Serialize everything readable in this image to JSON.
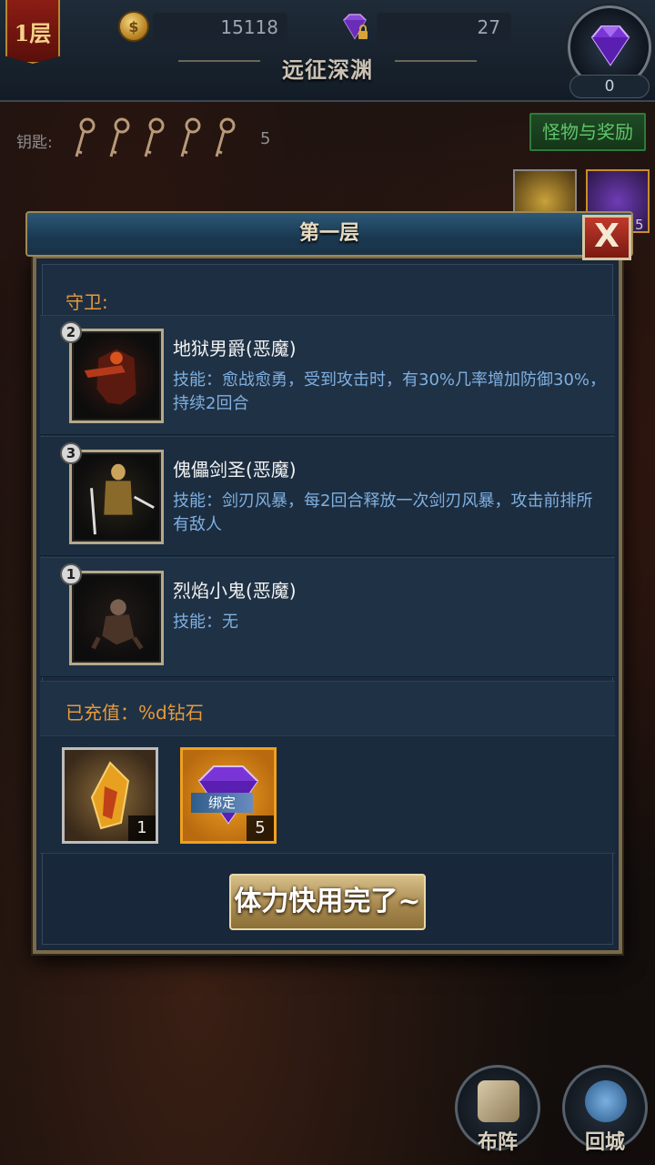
{
  "topbar": {
    "floor_badge": "1层",
    "coins": "15118",
    "diamonds": "27",
    "gem_count": "0",
    "title": "远征深渊"
  },
  "keys": {
    "label": "钥匙:",
    "count": "5"
  },
  "monster_reward_button": "怪物与奖励",
  "background_item_count": "5",
  "modal": {
    "title": "第一层",
    "close_label": "X",
    "guard_label": "守卫:",
    "guards": [
      {
        "level": "2",
        "name": "地狱男爵(恶魔)",
        "skill": "技能：愈战愈勇，受到攻击时，有30%几率增加防御30%，持续2回合"
      },
      {
        "level": "3",
        "name": "傀儡剑圣(恶魔)",
        "skill": "技能：剑刃风暴，每2回合释放一次剑刃风暴，攻击前排所有敌人"
      },
      {
        "level": "1",
        "name": "烈焰小鬼(恶魔)",
        "skill": "技能：无"
      }
    ],
    "recharge_label": "已充值：%d钻石",
    "rewards": [
      {
        "count": "1",
        "bind_tag": ""
      },
      {
        "count": "5",
        "bind_tag": "绑定"
      }
    ],
    "stamina_button": "体力快用完了~"
  },
  "bottom_buttons": {
    "formation": "布阵",
    "return_city": "回城"
  }
}
